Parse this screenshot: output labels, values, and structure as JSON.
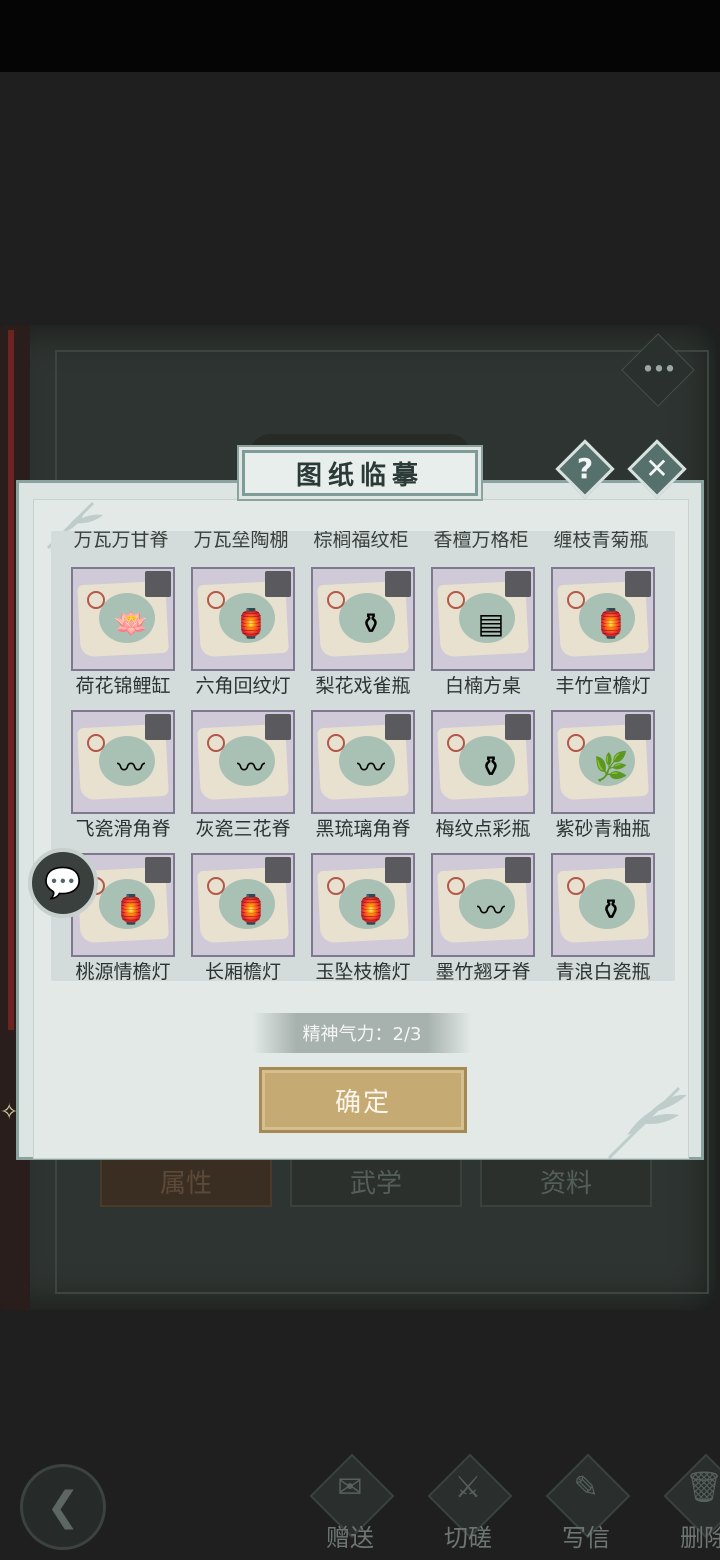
{
  "dialog": {
    "title": "图纸临摹",
    "help_icon": "?",
    "close_icon": "✕",
    "cut_off_row": [
      "万瓦万甘脊",
      "万瓦垒陶棚",
      "棕榈福纹柜",
      "香檀万格柜",
      "缠枝青菊瓶"
    ],
    "items": [
      {
        "name": "荷花锦鲤缸",
        "icon": "lotus-fish-jar-icon",
        "glyph": "🪷"
      },
      {
        "name": "六角回纹灯",
        "icon": "hexagon-lantern-icon",
        "glyph": "🏮"
      },
      {
        "name": "梨花戏雀瓶",
        "icon": "pear-blossom-vase-icon",
        "glyph": "⚱"
      },
      {
        "name": "白楠方桌",
        "icon": "square-table-icon",
        "glyph": "▤"
      },
      {
        "name": "丰竹宣檐灯",
        "icon": "eave-lantern-icon",
        "glyph": "🏮"
      },
      {
        "name": "飞瓷滑角脊",
        "icon": "ridge-tile-icon",
        "glyph": "〰"
      },
      {
        "name": "灰瓷三花脊",
        "icon": "ridge-tile-icon",
        "glyph": "〰"
      },
      {
        "name": "黑琉璃角脊",
        "icon": "ridge-tile-icon",
        "glyph": "〰"
      },
      {
        "name": "梅纹点彩瓶",
        "icon": "plum-vase-icon",
        "glyph": "⚱"
      },
      {
        "name": "紫砂青釉瓶",
        "icon": "plant-vase-icon",
        "glyph": "🌿"
      },
      {
        "name": "桃源情檐灯",
        "icon": "pink-lantern-icon",
        "glyph": "🏮"
      },
      {
        "name": "长厢檐灯",
        "icon": "long-lantern-icon",
        "glyph": "🏮"
      },
      {
        "name": "玉坠枝檐灯",
        "icon": "jade-lantern-icon",
        "glyph": "🏮"
      },
      {
        "name": "墨竹翘牙脊",
        "icon": "ridge-tile-icon",
        "glyph": "〰"
      },
      {
        "name": "青浪白瓷瓶",
        "icon": "porcelain-vase-icon",
        "glyph": "⚱"
      }
    ],
    "spirit_text": "精神气力：2/3",
    "confirm_label": "确定"
  },
  "background": {
    "tabs": [
      "属性",
      "武学",
      "资料"
    ],
    "more_icon": "•••"
  },
  "chat_icon": "💬",
  "bottom": {
    "back_icon": "❮",
    "actions": [
      {
        "label": "赠送",
        "icon": "scroll-gift-icon",
        "glyph": "✉"
      },
      {
        "label": "切磋",
        "icon": "swords-icon",
        "glyph": "⚔"
      },
      {
        "label": "写信",
        "icon": "letter-icon",
        "glyph": "✎"
      },
      {
        "label": "删除",
        "icon": "trash-icon",
        "glyph": "🗑"
      }
    ]
  },
  "colors": {
    "dialog_bg": "#dde5e3",
    "dialog_border": "#8aa39f",
    "card_bg": "#cfc9d8",
    "confirm_bg": "#c6aa74",
    "page_bg": "#1f1f1f"
  }
}
